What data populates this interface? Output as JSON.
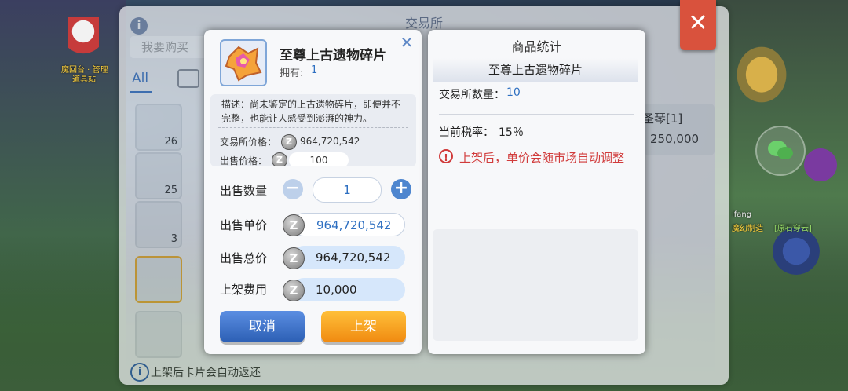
{
  "background": {
    "npc_label_1": "魔回台 · 管理",
    "npc_label_2": "道具站",
    "player_name": "ifang",
    "player_tag_1": "魔幻制造",
    "player_tag_2": "[原石穿云]"
  },
  "exchange": {
    "title": "交易所",
    "info_icon": "i",
    "close_icon": "✕",
    "search_placeholder": "我要购买",
    "tab_all": "All",
    "slot_counts": [
      "26",
      "25",
      "3"
    ],
    "right_item_name": "圣琴[1]",
    "right_item_price": "250,000",
    "footer_text": "上架后卡片会自动返还"
  },
  "sell_panel": {
    "item_name": "至尊上古遗物碎片",
    "own_label": "拥有:",
    "own_value": "1",
    "close_icon": "✕",
    "description": "描述：尚未鉴定的上古遗物碎片，即便并不完整，也能让人感受到澎湃的神力。",
    "exchange_price_label": "交易所价格：",
    "exchange_price_value": "964,720,542",
    "sell_price_label": "出售价格：",
    "sell_price_value": "100",
    "quantity_label": "出售数量",
    "quantity_value": "1",
    "minus_label": "−",
    "plus_label": "+",
    "unit_price_label": "出售单价",
    "unit_price_value": "964,720,542",
    "total_price_label": "出售总价",
    "total_price_value": "964,720,542",
    "listing_fee_label": "上架费用",
    "listing_fee_value": "10,000",
    "coin_symbol": "Z",
    "cancel_button": "取消",
    "list_button": "上架"
  },
  "stats_panel": {
    "title": "商品统计",
    "item_name": "至尊上古遗物碎片",
    "exchange_count_label": "交易所数量：",
    "exchange_count_value": "10",
    "tax_label": "当前税率：",
    "tax_value": "15％",
    "warning_icon": "!",
    "warning_text": "上架后，单价会随市场自动调整"
  },
  "colors": {
    "accent_blue": "#2d6fc1",
    "warning_red": "#d13b3b",
    "button_orange": "#f08a10",
    "button_blue": "#2c5fb4"
  }
}
